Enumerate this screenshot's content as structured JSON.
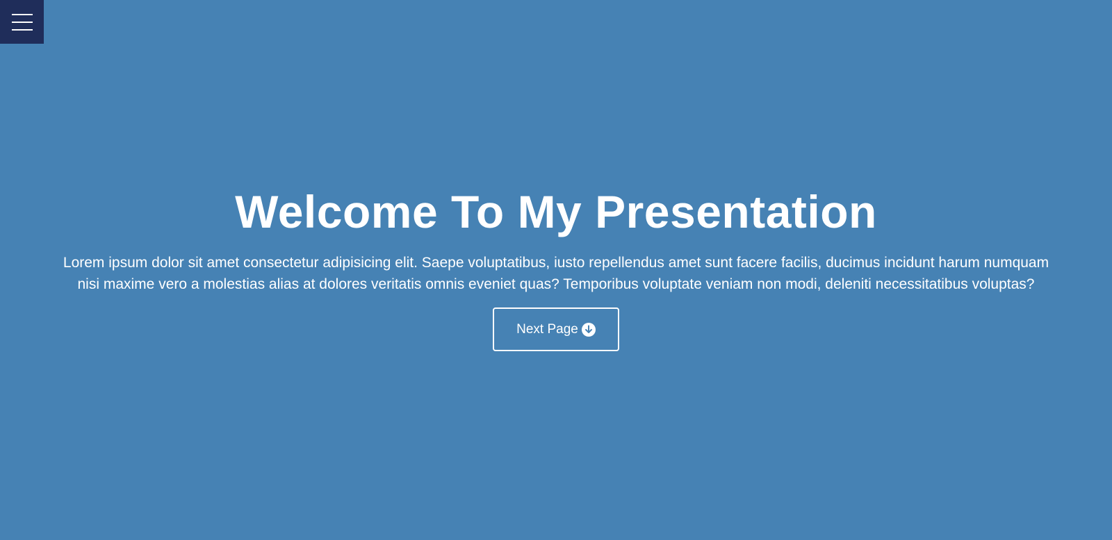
{
  "nav": {
    "menu_icon": "hamburger-menu-icon"
  },
  "hero": {
    "title": "Welcome To My Presentation",
    "text": "Lorem ipsum dolor sit amet consectetur adipisicing elit. Saepe voluptatibus, iusto repellendus amet sunt facere facilis, ducimus incidunt harum numquam nisi maxime vero a molestias alias at dolores veritatis omnis eveniet quas? Temporibus voluptate veniam non modi, deleniti necessitatibus voluptas?",
    "button_label": "Next Page",
    "button_icon": "arrow-circle-down-icon"
  },
  "colors": {
    "background": "#4682b4",
    "menu_background": "#1f2d5a",
    "text": "#ffffff"
  }
}
